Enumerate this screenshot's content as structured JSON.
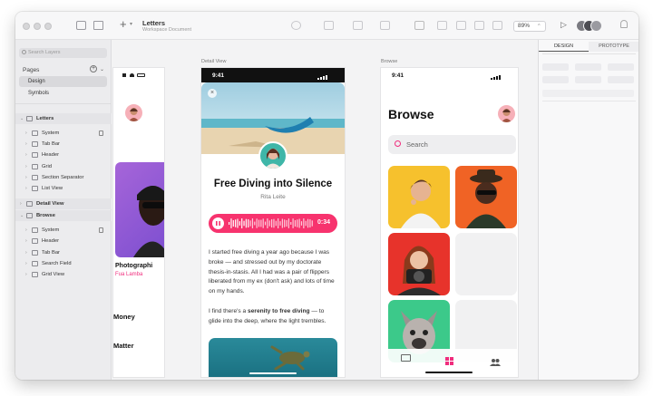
{
  "toolbar": {
    "doc_title": "Letters",
    "doc_subtitle": "Workspace Document",
    "zoom": "89%"
  },
  "sidebar": {
    "search_placeholder": "Search Layers",
    "pages_header": "Pages",
    "pages": [
      "Design",
      "Symbols"
    ],
    "layers": [
      {
        "label": "Letters",
        "level": 0,
        "expanded": true,
        "bold": true
      },
      {
        "label": "System",
        "level": 1,
        "locked": true
      },
      {
        "label": "Tab Bar",
        "level": 1
      },
      {
        "label": "Header",
        "level": 1
      },
      {
        "label": "Grid",
        "level": 1
      },
      {
        "label": "Section Separator",
        "level": 1
      },
      {
        "label": "List View",
        "level": 1
      },
      {
        "label": "Detail View",
        "level": 0,
        "bold": true
      },
      {
        "label": "Browse",
        "level": 0,
        "expanded": true,
        "bold": true
      },
      {
        "label": "System",
        "level": 1,
        "locked": true
      },
      {
        "label": "Header",
        "level": 1
      },
      {
        "label": "Tab Bar",
        "level": 1
      },
      {
        "label": "Search Field",
        "level": 1
      },
      {
        "label": "Grid View",
        "level": 1
      }
    ]
  },
  "canvas": {
    "artboard_labels": {
      "detail": "Detail View",
      "browse": "Browse"
    },
    "letters_phone": {
      "card_title": "Photographi",
      "card_author": "Fua Lamba",
      "row1": "Money",
      "row2": "Matter"
    },
    "detail_phone": {
      "time": "9:41",
      "title": "Free Diving into Silence",
      "author": "Rita Leite",
      "audio_time": "0:34",
      "para1": "I started free diving a year ago because I was broke — and stressed out by my doctorate thesis-in-stasis. All I had was a pair of flippers liberated from my ex (don't ask) and lots of time on my hands.",
      "para2_pre": "I find there's a ",
      "para2_bold": "serenity to free diving",
      "para2_post": " — to glide into the deep, where the light trembles."
    },
    "browse_phone": {
      "time": "9:41",
      "title": "Browse",
      "search_placeholder": "Search"
    }
  },
  "inspector": {
    "tabs": [
      "DESIGN",
      "PROTOTYPE"
    ]
  },
  "colors": {
    "accent_pink": "#f02d7d",
    "audio_pink": "#f7336e"
  }
}
